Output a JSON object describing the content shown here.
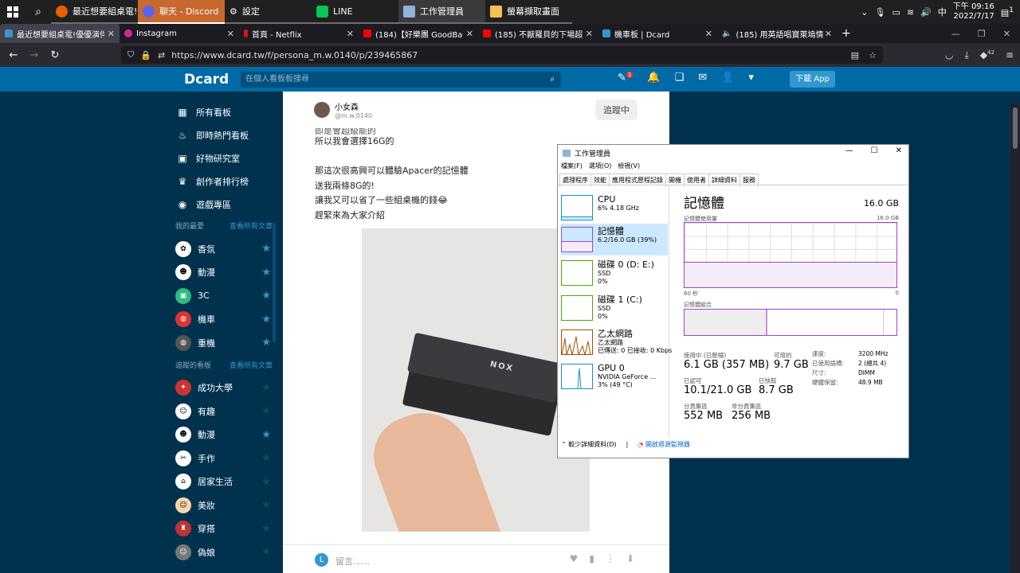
{
  "taskbar": {
    "apps": [
      {
        "label": "最近想要組桌電!優...",
        "icon": "firefox-icon",
        "color": "#e66000"
      },
      {
        "label": "聊天 - Discord",
        "icon": "discord-icon",
        "color": "#5865f2"
      },
      {
        "label": "設定",
        "icon": "gear-icon",
        "color": "#ffffff"
      },
      {
        "label": "LINE",
        "icon": "line-icon",
        "color": "#06c755"
      },
      {
        "label": "工作管理員",
        "icon": "task-manager-icon",
        "color": "#8fb3d9"
      },
      {
        "label": "螢幕擷取畫面",
        "icon": "folder-icon",
        "color": "#f2c14e"
      }
    ],
    "tray": {
      "lang": "中",
      "time": "下午 09:16",
      "date": "2022/7/17",
      "notif": "1"
    }
  },
  "tabs": [
    {
      "label": "最近想要組桌電!優優演伴中-牛",
      "color": "#3397cf"
    },
    {
      "label": "Instagram",
      "color": "#d6249f"
    },
    {
      "label": "首頁 - Netflix",
      "color": "#e50914"
    },
    {
      "label": "(184)【好樂團 GoodBand】",
      "color": "#ff0000"
    },
    {
      "label": "(185) 不厭羅貝的下場超慘！",
      "color": "#ff0000"
    },
    {
      "label": "機車板 | Dcard",
      "color": "#3397cf"
    },
    {
      "label": "(185) 用英語唱寶萊塢情歌 莫斯",
      "color": "#888888"
    }
  ],
  "addressbar": {
    "url": "https://www.dcard.tw/f/persona_m.w.0140/p/239465867",
    "badge": "42"
  },
  "dcard": {
    "logo": "Dcard",
    "search_placeholder": "在個人看板板搜尋",
    "notif_count": "1",
    "download": "下載 App",
    "nav": [
      {
        "label": "所有看板",
        "icon": "board-icon",
        "glyph": "▦"
      },
      {
        "label": "即時熱門看板",
        "icon": "fire-icon",
        "glyph": "♨"
      },
      {
        "label": "好物研究室",
        "icon": "gift-icon",
        "glyph": "▣"
      },
      {
        "label": "創作者排行榜",
        "icon": "trophy-icon",
        "glyph": "♛"
      },
      {
        "label": "遊戲專區",
        "icon": "gamepad-icon",
        "glyph": "◉"
      }
    ],
    "fav_title": "我的最愛",
    "fav_link": "查看所有文章",
    "favorites": [
      {
        "label": "香氛",
        "starred": true
      },
      {
        "label": "動漫",
        "starred": true
      },
      {
        "label": "3C",
        "starred": true
      },
      {
        "label": "機車",
        "starred": true
      },
      {
        "label": "重機",
        "starred": true
      }
    ],
    "follow_title": "追蹤的看板",
    "follow_link": "查看所有文章",
    "followed": [
      {
        "label": "成功大學",
        "starred": false
      },
      {
        "label": "有趣",
        "starred": false
      },
      {
        "label": "動漫",
        "starred": true
      },
      {
        "label": "手作",
        "starred": false
      },
      {
        "label": "居家生活",
        "starred": false
      },
      {
        "label": "美妝",
        "starred": false
      },
      {
        "label": "穿搭",
        "starred": false
      },
      {
        "label": "偽娘",
        "starred": false
      }
    ]
  },
  "post": {
    "author": "小女森",
    "handle": "@m.w.0140",
    "follow": "追蹤中",
    "cut_line": "即是會超級能的",
    "lines": [
      "所以我會選擇16G的",
      "",
      "那這次很高興可以體驗Apacer的記憶體",
      "送我兩條8G的!",
      "讓我又可以省了一些組桌機的錢😂",
      "趕緊來為大家介紹"
    ],
    "ram_label": "NOX",
    "comment_avatar": "L",
    "comment_placeholder": "留言......"
  },
  "taskmgr": {
    "title": "工作管理員",
    "menu": [
      "檔案(F)",
      "選項(O)",
      "檢視(V)"
    ],
    "tabs": [
      "處理程序",
      "效能",
      "應用程式歷程記錄",
      "開機",
      "使用者",
      "詳細資料",
      "服務"
    ],
    "resources": [
      {
        "name": "CPU",
        "l1": "6% 4.18 GHz",
        "l2": "",
        "color": "#1191c8"
      },
      {
        "name": "記憶體",
        "l1": "6.2/16.0 GB (39%)",
        "l2": "",
        "color": "#9d46c8"
      },
      {
        "name": "磁碟 0 (D: E:)",
        "l1": "SSD",
        "l2": "0%",
        "color": "#4da60c"
      },
      {
        "name": "磁碟 1 (C:)",
        "l1": "SSD",
        "l2": "0%",
        "color": "#4da60c"
      },
      {
        "name": "乙太網路",
        "l1": "乙太網路",
        "l2": "已傳送: 0 已接收: 0 Kbps",
        "color": "#a74f01"
      },
      {
        "name": "GPU 0",
        "l1": "NVIDIA GeForce ...",
        "l2": "3% (49 °C)",
        "color": "#1191c8"
      }
    ],
    "heading": "記憶體",
    "capacity": "16.0 GB",
    "usage_label": "記憶體使用量",
    "usage_max": "16.0 GB",
    "time_left": "60 秒",
    "time_right": "0",
    "comp_label": "記憶體組合",
    "in_use_label": "使用中 (已壓縮)",
    "in_use": "6.1 GB (357 MB)",
    "avail_label": "可用的",
    "avail": "9.7 GB",
    "committed_label": "已認可",
    "committed": "10.1/21.0 GB",
    "cached_label": "已快取",
    "cached": "8.7 GB",
    "paged_label": "分頁集區",
    "paged": "552 MB",
    "nonpaged_label": "非分頁集區",
    "nonpaged": "256 MB",
    "kv": [
      {
        "k": "速度:",
        "v": "3200 MHz"
      },
      {
        "k": "已使用插槽:",
        "v": "2 (總共 4)"
      },
      {
        "k": "尺寸:",
        "v": "DIMM"
      },
      {
        "k": "硬體保留:",
        "v": "48.9 MB"
      }
    ],
    "fewer": "較少詳細資料(D)",
    "resmon": "開啟資源監視器",
    "usage_fraction": 0.39
  }
}
